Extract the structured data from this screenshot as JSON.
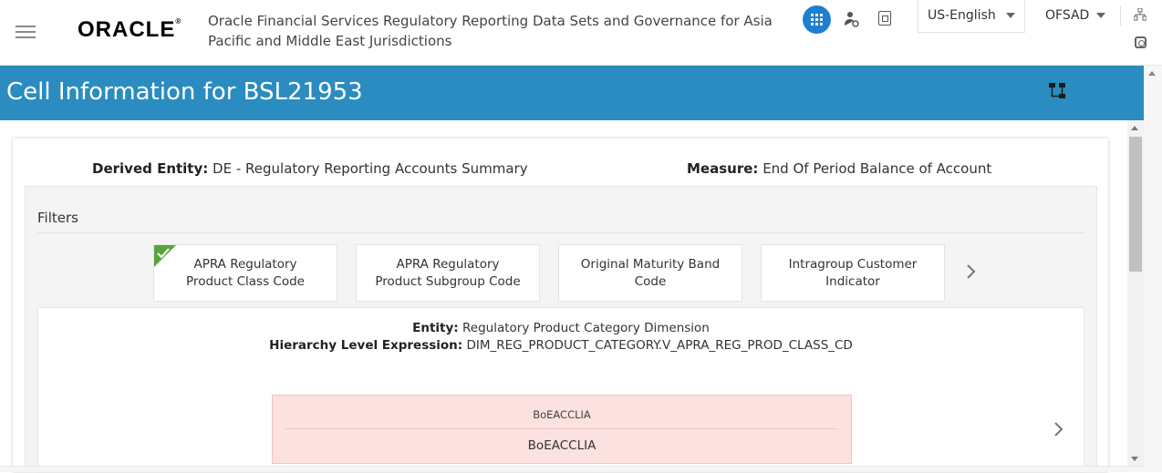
{
  "header": {
    "brand": "ORACLE",
    "app_title": "Oracle Financial Services Regulatory Reporting Data Sets and Governance for Asia Pacific and Middle East Jurisdictions",
    "language": "US-English",
    "user": "OFSAD",
    "icons": [
      "hamburger-menu-icon",
      "apps-grid-icon",
      "user-admin-icon",
      "book-icon",
      "network-icon",
      "clock-icon"
    ]
  },
  "page": {
    "title": "Cell Information for BSL21953",
    "title_bar_color": "#2a8cc0"
  },
  "summary": {
    "derived_entity_label": "Derived Entity:",
    "derived_entity_value": "DE - Regulatory Reporting Accounts Summary",
    "measure_label": "Measure:",
    "measure_value": "End Of Period Balance of Account"
  },
  "filters": {
    "label": "Filters",
    "tiles": [
      {
        "label": "APRA Regulatory Product Class Code",
        "selected": true
      },
      {
        "label": "APRA Regulatory Product Subgroup Code",
        "selected": false
      },
      {
        "label": "Original Maturity Band Code",
        "selected": false
      },
      {
        "label": "Intragroup Customer Indicator",
        "selected": false
      }
    ]
  },
  "detail": {
    "entity_label": "Entity:",
    "entity_value": "Regulatory Product Category Dimension",
    "hierarchy_label": "Hierarchy Level Expression:",
    "hierarchy_value": "DIM_REG_PRODUCT_CATEGORY.V_APRA_REG_PROD_CLASS_CD",
    "node": {
      "code": "BoEACCLIA",
      "value": "BoEACCLIA",
      "color": "#fbe1df"
    }
  }
}
